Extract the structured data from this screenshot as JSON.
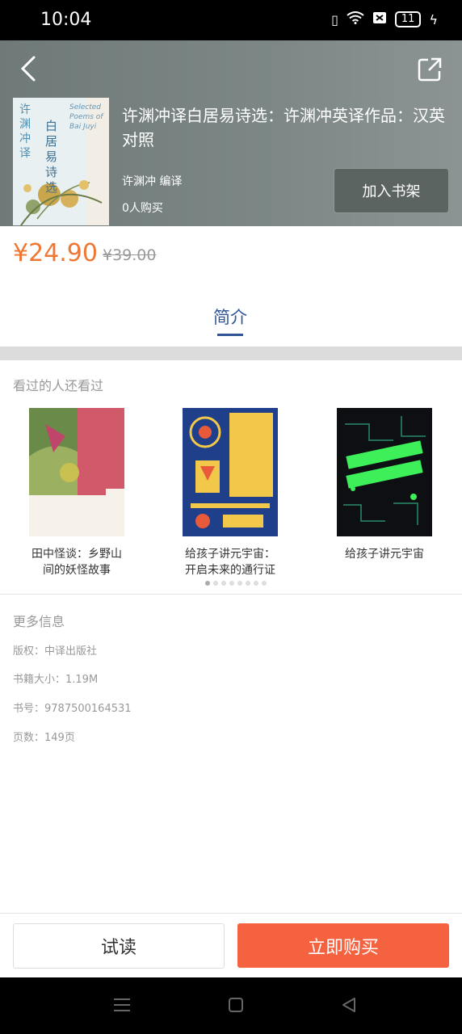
{
  "status": {
    "time": "10:04",
    "battery": "11"
  },
  "header": {
    "title": "许渊冲译白居易诗选：许渊冲英译作品：汉英对照",
    "author": "许渊冲 编译",
    "buyers": "0人购买",
    "add_shelf": "加入书架",
    "cover_text_left": "许渊冲译",
    "cover_text_main": "白居易诗选",
    "cover_text_en": "Selected Poems of Bai Juyi"
  },
  "price": {
    "current": "¥24.90",
    "original": "¥39.00"
  },
  "tab": {
    "intro": "简介"
  },
  "recommend": {
    "title": "看过的人还看过",
    "books": [
      {
        "label": "田中怪谈：乡野山间的妖怪故事",
        "cover_title": "田中怪谈"
      },
      {
        "label": "给孩子讲元宇宙：开启未来的通行证",
        "cover_title": "给孩子讲元宇宙"
      },
      {
        "label": "给孩子讲元宇宙",
        "cover_title": "给孩子讲元宇宙"
      }
    ]
  },
  "more": {
    "title": "更多信息",
    "copyright": "版权：中译出版社",
    "size": "书籍大小：1.19M",
    "isbn": "书号：9787500164531",
    "pages": "页数：149页"
  },
  "actions": {
    "try": "试读",
    "buy": "立即购买"
  },
  "colors": {
    "accent_price": "#ee7733",
    "tab_blue": "#2f5597",
    "buy_button": "#f4623f"
  }
}
